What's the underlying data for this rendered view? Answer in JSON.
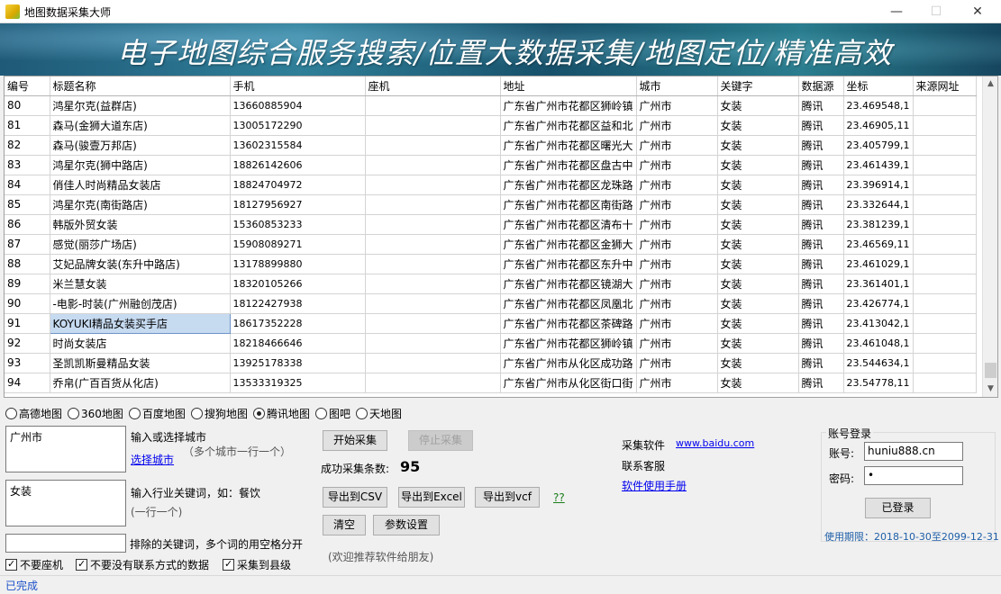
{
  "window": {
    "title": "地图数据采集大师",
    "minimize": "—",
    "maximize": "☐",
    "close": "✕"
  },
  "banner": {
    "text": "电子地图综合服务搜索/位置大数据采集/地图定位/精准高效"
  },
  "grid": {
    "columns": [
      "编号",
      "标题名称",
      "手机",
      "座机",
      "地址",
      "城市",
      "关键字",
      "数据源",
      "坐标",
      "来源网址"
    ],
    "rows": [
      [
        "80",
        "鸿星尔克(益群店)",
        "13660885904",
        "",
        "广东省广州市花都区狮岭镇",
        "广州市",
        "女装",
        "腾讯",
        "23.469548,1",
        ""
      ],
      [
        "81",
        "森马(金狮大道东店)",
        "13005172290",
        "",
        "广东省广州市花都区益和北",
        "广州市",
        "女装",
        "腾讯",
        "23.46905,11",
        ""
      ],
      [
        "82",
        "森马(骏壹万邦店)",
        "13602315584",
        "",
        "广东省广州市花都区曙光大",
        "广州市",
        "女装",
        "腾讯",
        "23.405799,1",
        ""
      ],
      [
        "83",
        "鸿星尔克(狮中路店)",
        "18826142606",
        "",
        "广东省广州市花都区盘古中",
        "广州市",
        "女装",
        "腾讯",
        "23.461439,1",
        ""
      ],
      [
        "84",
        "俏佳人时尚精品女装店",
        "18824704972",
        "",
        "广东省广州市花都区龙珠路",
        "广州市",
        "女装",
        "腾讯",
        "23.396914,1",
        ""
      ],
      [
        "85",
        "鸿星尔克(南街路店)",
        "18127956927",
        "",
        "广东省广州市花都区南街路",
        "广州市",
        "女装",
        "腾讯",
        "23.332644,1",
        ""
      ],
      [
        "86",
        "韩版外贸女装",
        "15360853233",
        "",
        "广东省广州市花都区清布十",
        "广州市",
        "女装",
        "腾讯",
        "23.381239,1",
        ""
      ],
      [
        "87",
        "感觉(丽莎广场店)",
        "15908089271",
        "",
        "广东省广州市花都区金狮大",
        "广州市",
        "女装",
        "腾讯",
        "23.46569,11",
        ""
      ],
      [
        "88",
        "艾妃品牌女装(东升中路店)",
        "13178899880",
        "",
        "广东省广州市花都区东升中",
        "广州市",
        "女装",
        "腾讯",
        "23.461029,1",
        ""
      ],
      [
        "89",
        "米兰慧女装",
        "18320105266",
        "",
        "广东省广州市花都区镜湖大",
        "广州市",
        "女装",
        "腾讯",
        "23.361401,1",
        ""
      ],
      [
        "90",
        "-电影-时装(广州融创茂店)",
        "18122427938",
        "",
        "广东省广州市花都区凤凰北",
        "广州市",
        "女装",
        "腾讯",
        "23.426774,1",
        ""
      ],
      [
        "91",
        "KOYUKI精品女装买手店",
        "18617352228",
        "",
        "广东省广州市花都区茶碑路",
        "广州市",
        "女装",
        "腾讯",
        "23.413042,1",
        ""
      ],
      [
        "92",
        "时尚女装店",
        "18218466646",
        "",
        "广东省广州市花都区狮岭镇",
        "广州市",
        "女装",
        "腾讯",
        "23.461048,1",
        ""
      ],
      [
        "93",
        "圣凯凯斯曼精品女装",
        "13925178338",
        "",
        "广东省广州市从化区成功路",
        "广州市",
        "女装",
        "腾讯",
        "23.544634,1",
        ""
      ],
      [
        "94",
        "乔帛(广百百货从化店)",
        "13533319325",
        "",
        "广东省广州市从化区街口街",
        "广州市",
        "女装",
        "腾讯",
        "23.54778,11",
        ""
      ]
    ],
    "selected_row_index": 11,
    "selected_col_index": 1
  },
  "maps": {
    "options": [
      "高德地图",
      "360地图",
      "百度地图",
      "搜狗地图",
      "腾讯地图",
      "图吧",
      "天地图"
    ],
    "selected": "腾讯地图"
  },
  "city": {
    "value": "广州市",
    "label": "输入或选择城市",
    "hint": "（多个城市一行一个）",
    "select_link": "选择城市"
  },
  "keyword": {
    "value": "女装",
    "label": "输入行业关键词，如：餐饮",
    "hint": "(一行一个)"
  },
  "exclude": {
    "value": "",
    "label": "排除的关键词，多个词的用空格分开"
  },
  "checks": [
    {
      "label": "不要座机",
      "checked": true
    },
    {
      "label": "不要没有联系方式的数据",
      "checked": true
    },
    {
      "label": "采集到县级",
      "checked": true
    }
  ],
  "actions": {
    "start": "开始采集",
    "stop": "停止采集",
    "success_label": "成功采集条数:",
    "success_count": "95",
    "export_csv": "导出到CSV",
    "export_excel": "导出到Excel",
    "export_vcf": "导出到vcf",
    "help_link": "??",
    "clear": "清空",
    "settings": "参数设置",
    "recommend": "(欢迎推荐软件给朋友)"
  },
  "info": {
    "software_label": "采集软件",
    "software_link": "www.baidu.com",
    "contact_label": "联系客服",
    "manual_link": "软件使用手册"
  },
  "account": {
    "legend": "账号登录",
    "user_label": "账号:",
    "user_value": "huniu888.cn",
    "pass_label": "密码:",
    "pass_value": "•",
    "login_button": "已登录",
    "validity": "使用期限：2018-10-30至2099-12-31"
  },
  "status": {
    "text": "已完成"
  }
}
